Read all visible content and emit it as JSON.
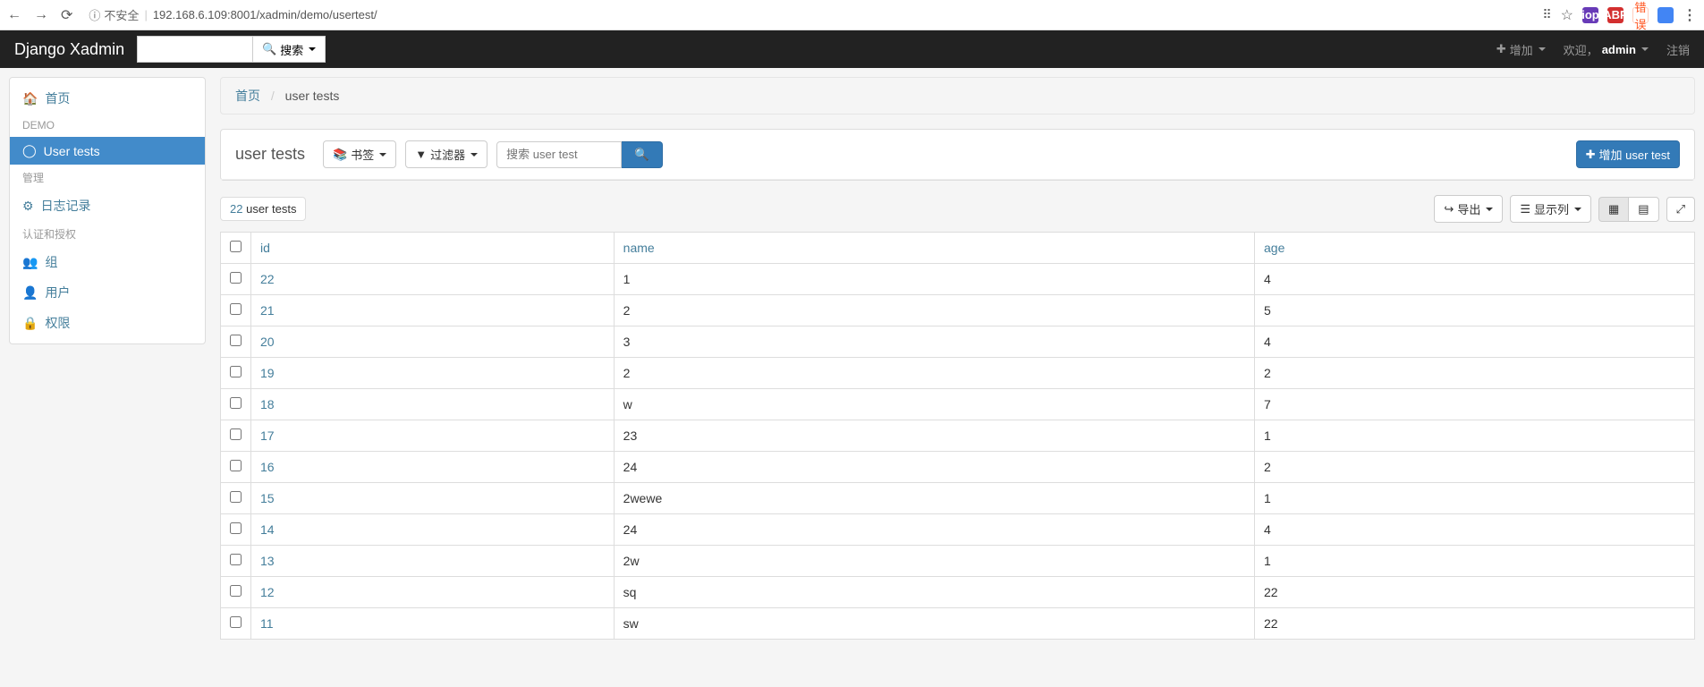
{
  "browser": {
    "insecure_label": "不安全",
    "url": "192.168.6.109:8001/xadmin/demo/usertest/",
    "error_label": "错误"
  },
  "navbar": {
    "brand": "Django Xadmin",
    "search_btn": "搜索",
    "add_label": "增加",
    "welcome_prefix": "欢迎，",
    "username": "admin",
    "logout": "注销"
  },
  "sidebar": {
    "home": "首页",
    "sec_demo": "DEMO",
    "user_tests": "User tests",
    "sec_admin": "管理",
    "logs": "日志记录",
    "sec_auth": "认证和授权",
    "groups": "组",
    "users": "用户",
    "perms": "权限"
  },
  "breadcrumb": {
    "home": "首页",
    "current": "user tests"
  },
  "panel": {
    "title": "user tests",
    "bookmark": "书签",
    "filter": "过滤器",
    "search_placeholder": "搜索 user test",
    "add_btn": "增加 user test"
  },
  "toolbar": {
    "count_num": "22",
    "count_label": "user tests",
    "export": "导出",
    "columns": "显示列"
  },
  "table": {
    "headers": {
      "id": "id",
      "name": "name",
      "age": "age"
    },
    "rows": [
      {
        "id": "22",
        "name": "1",
        "age": "4"
      },
      {
        "id": "21",
        "name": "2",
        "age": "5"
      },
      {
        "id": "20",
        "name": "3",
        "age": "4"
      },
      {
        "id": "19",
        "name": "2",
        "age": "2"
      },
      {
        "id": "18",
        "name": "w",
        "age": "7"
      },
      {
        "id": "17",
        "name": "23",
        "age": "1"
      },
      {
        "id": "16",
        "name": "24",
        "age": "2"
      },
      {
        "id": "15",
        "name": "2wewe",
        "age": "1"
      },
      {
        "id": "14",
        "name": "24",
        "age": "4"
      },
      {
        "id": "13",
        "name": "2w",
        "age": "1"
      },
      {
        "id": "12",
        "name": "sq",
        "age": "22"
      },
      {
        "id": "11",
        "name": "sw",
        "age": "22"
      }
    ]
  }
}
